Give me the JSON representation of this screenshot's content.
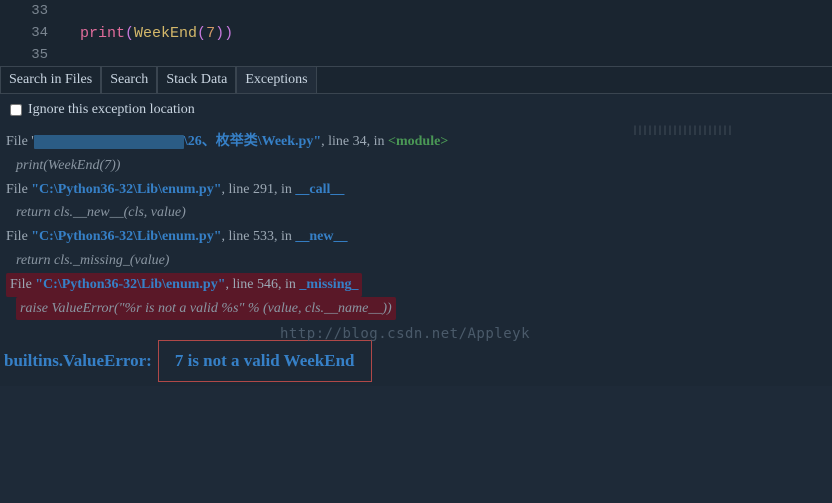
{
  "editor": {
    "lines": [
      {
        "num": "33",
        "code": ""
      },
      {
        "num": "34",
        "print": "print",
        "call": "WeekEnd",
        "arg": "7"
      },
      {
        "num": "35",
        "code": ""
      }
    ]
  },
  "tabs": {
    "items": [
      {
        "label": "Search in Files"
      },
      {
        "label": "Search"
      },
      {
        "label": "Stack Data"
      },
      {
        "label": "Exceptions",
        "active": true
      }
    ]
  },
  "checkbox": {
    "label": "Ignore this exception location"
  },
  "traceback": {
    "frames": [
      {
        "prefix": "File '",
        "path_suffix": "\\26、枚举类\\Week.py\"",
        "line_info": ", line 34, in ",
        "scope": "<module>",
        "code": "print(WeekEnd(7))"
      },
      {
        "prefix": "File ",
        "path": "\"C:\\Python36-32\\Lib\\enum.py\"",
        "line_info": ", line 291, in ",
        "scope": "__call__",
        "code": "return cls.__new__(cls, value)"
      },
      {
        "prefix": "File ",
        "path": "\"C:\\Python36-32\\Lib\\enum.py\"",
        "line_info": ", line 533, in ",
        "scope": "__new__",
        "code": "return cls._missing_(value)"
      },
      {
        "prefix": "File ",
        "path": "\"C:\\Python36-32\\Lib\\enum.py\"",
        "line_info": ", line 546, in ",
        "scope": "_missing_",
        "code": "raise ValueError(\"%r is not a valid %s\" % (value, cls.__name__))",
        "highlighted": true
      }
    ]
  },
  "error": {
    "type": "builtins.ValueError:",
    "message": "7 is not a valid WeekEnd"
  },
  "watermark": "http://blog.csdn.net/Appleyk"
}
